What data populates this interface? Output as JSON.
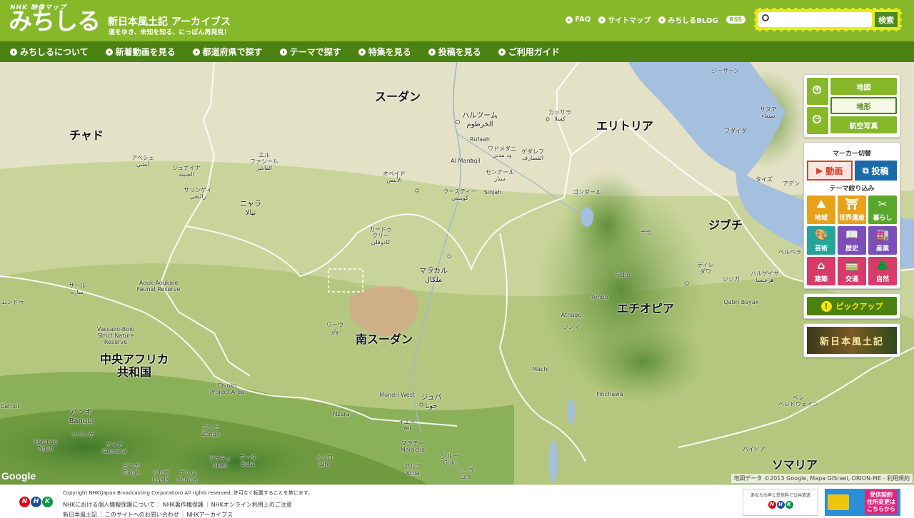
{
  "header": {
    "logo_nhk": "NHK 映像マップ",
    "logo_main": "みちしる",
    "logo_title": "新日本風土記 アーカイブス",
    "logo_tagline": "道をゆき、未知を知る、にっぽん再発見！",
    "links": [
      "FAQ",
      "サイトマップ",
      "みちしるBLOG"
    ],
    "rss": "RSS",
    "search_placeholder": "",
    "search_button": "検索"
  },
  "nav": [
    "みちしるについて",
    "新着動画を見る",
    "都道府県で探す",
    "テーマで探す",
    "特集を見る",
    "投稿を見る",
    "ご利用ガイド"
  ],
  "map": {
    "countries": [
      {
        "name": "スーダン"
      },
      {
        "name": "チャド"
      },
      {
        "name": "エリトリア"
      },
      {
        "name": "ジブチ"
      },
      {
        "name": "エチオピア"
      },
      {
        "name": "南スーダン"
      },
      {
        "name": "中央アフリカ\n共和国"
      },
      {
        "name": "ソマリア"
      }
    ],
    "cities": [
      "ハルツーム\nالخرطوم",
      "ワドメダニ\nود مدني",
      "ゲダレフ\nالقضارف",
      "カッサラ\nكسلا",
      "アスマラ",
      "オベイド\nالأبيض",
      "センナール\nسنار",
      "クースティー\nكوستي",
      "エル\nファシール\nالفاشر",
      "ニャラ\nنيالا",
      "アベシェ\nأبشي",
      "ジュナイナ\nالجنينة",
      "サリンゲイ\nزالنجي",
      "カードゥ\nクリー\nكادوقلي",
      "マラカル\nملكال",
      "ワーウ\nواو",
      "ジュバ\nجوبا",
      "ゴンダール",
      "デセ",
      "ディレ\nダワ",
      "ジジガ",
      "ハルゲイサ\nهرجيسا",
      "ベルベラ",
      "サール\nساره",
      "ムンドゥ",
      "バンギ\nBangui",
      "ズンゴ\nZongo",
      "イエイ\nYei",
      "マラチャ\nMaracha",
      "アルア\nArua",
      "グルー\nGulu",
      "リーラ\nLira",
      "ベレ\nベレドウェイン",
      "バイドア",
      "サヌア\nصنعاء",
      "ジーザーン",
      "アデン",
      "タイズ",
      "フダイダ",
      "ゼムレ",
      "Rufaah",
      "Al Manaqil",
      "Sinjah",
      "Aouk-Aoukale\nFaunal Reserve",
      "Vassako-Bolo\nStrict Nature\nReserve",
      "Chinko\nProject Area",
      "Mundri West",
      "Fiche",
      "Ambo",
      "Atnago",
      "ジンマ",
      "Machi",
      "Finchawa",
      "Qabri Bayax",
      "Nzara",
      "リベンゲ",
      "ゲメナ\nGemena",
      "ピンガ\nBinga",
      "リサラ\nLisala",
      "ブンバ\nBumba",
      "アケティ\nAketi",
      "ブータ\nButa",
      "イシロ\nIsiro",
      "Carnot",
      "Forel de\nNgiio"
    ],
    "google_logo": "Google",
    "copyright": "地図データ ©2013 Google, Mapa GISrael, ORION-ME - 利用規約"
  },
  "panel": {
    "map_types": [
      "地図",
      "地形",
      "航空写真"
    ],
    "active_map_type": "地形",
    "marker_title": "マーカー切替",
    "marker_video": "動画",
    "marker_post": "投稿",
    "theme_title": "テーマ絞り込み",
    "themes": [
      {
        "label": "地域",
        "color": "#e8a21a",
        "icon": "mountain-icon",
        "glyph": "⛰"
      },
      {
        "label": "世界遺産",
        "color": "#e8a21a",
        "icon": "temple-icon",
        "glyph": "⛩"
      },
      {
        "label": "暮らし",
        "color": "#5aa82a",
        "icon": "utensils-icon",
        "glyph": "✂"
      },
      {
        "label": "芸術",
        "color": "#25a49a",
        "icon": "palette-icon",
        "glyph": "🎨"
      },
      {
        "label": "歴史",
        "color": "#7b4fb8",
        "icon": "book-icon",
        "glyph": "📖"
      },
      {
        "label": "産業",
        "color": "#7b4fb8",
        "icon": "factory-icon",
        "glyph": "🏭"
      },
      {
        "label": "建築",
        "color": "#d83a6a",
        "icon": "house-icon",
        "glyph": "⌂"
      },
      {
        "label": "交通",
        "color": "#d83a6a",
        "icon": "train-icon",
        "glyph": "🚃"
      },
      {
        "label": "自然",
        "color": "#d83a6a",
        "icon": "tree-icon",
        "glyph": "🌲"
      }
    ],
    "pickup": "ピックアップ",
    "banner": "新日本風土記"
  },
  "footer": {
    "nhk": [
      "N",
      "H",
      "K"
    ],
    "copyright": "Copyright NHK(Japan Broadcasting Corporation) All rights reserved. 許可なく転載することを禁じます。",
    "links1": [
      "NHKにおける個人情報保護について",
      "NHK著作権保護",
      "NHKオンライン利用上のご注意"
    ],
    "links2": [
      "新日本風土記",
      "このサイトへのお問い合わせ",
      "NHKアーカイブス"
    ],
    "ad1_text": "あなたの声と受信料で公共放送",
    "ad2_text": "受信契約\n住所変更は\nこちらから"
  },
  "colors": {
    "header_green": "#86b82a",
    "nav_green": "#4c8212",
    "accent_yellow": "#e6ea1e"
  }
}
